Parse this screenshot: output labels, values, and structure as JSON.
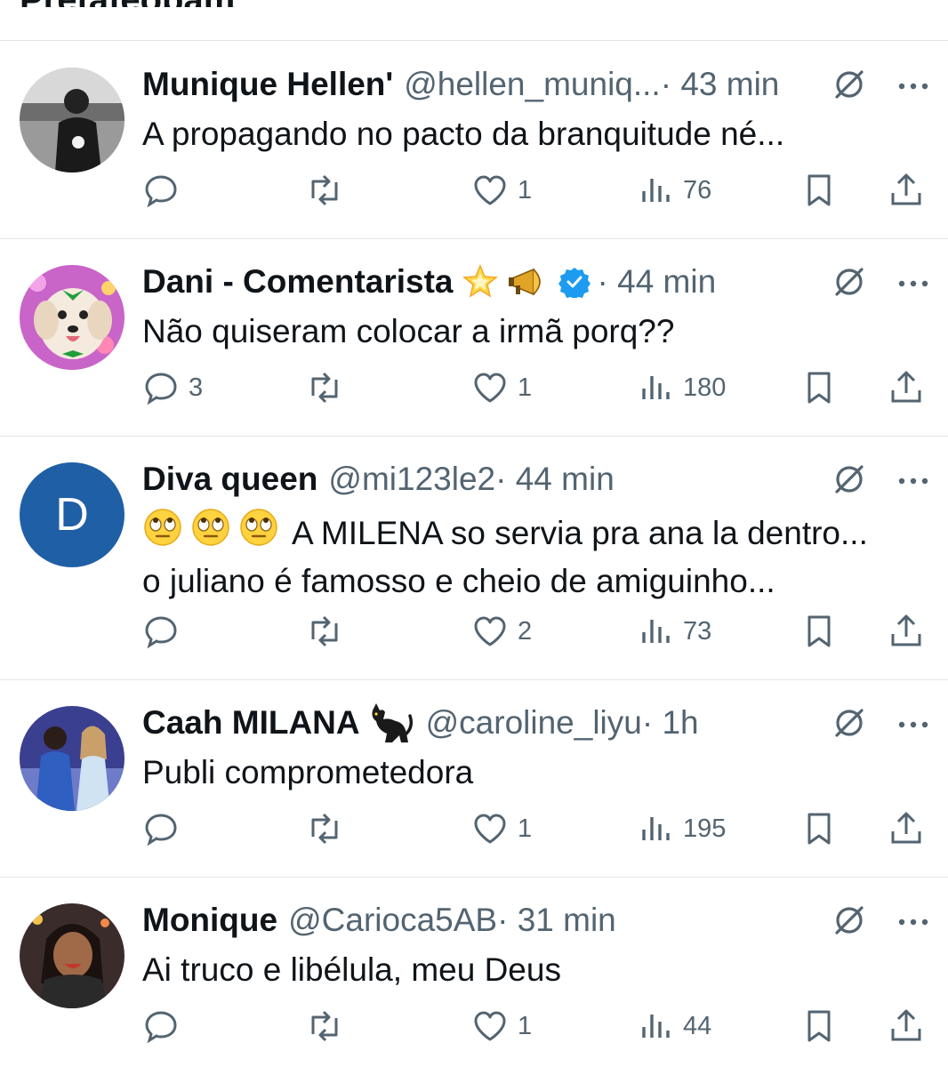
{
  "page": {
    "title_partial": "Pretafeopam"
  },
  "colors": {
    "text": "#0f1419",
    "secondary": "#536471",
    "divider": "#e1e6ea",
    "verified": "#1d9bf0"
  },
  "tweets": [
    {
      "name": "Munique Hellen'",
      "handle": "@hellen_muniq...",
      "time": "· 43 min",
      "lines": [
        "A propagando no pacto da branquitude né..."
      ],
      "replies": "",
      "retweets": "",
      "likes": "1",
      "views": "76",
      "avatar": "photo-person"
    },
    {
      "name": "Dani - Comentarista",
      "handle": "",
      "time": "· 44 min",
      "emojis": [
        "glowing-star-emoji",
        "megaphone-emoji"
      ],
      "verified": true,
      "lines": [
        "Não quiseram colocar a irmã porq??"
      ],
      "replies": "3",
      "retweets": "",
      "likes": "1",
      "views": "180",
      "avatar": "photo-dog"
    },
    {
      "name": "Diva queen",
      "handle": "@mi123le2",
      "time": "· 44 min",
      "lines": [
        "A MILENA so servia pra ana la dentro...",
        "o juliano é famosso e cheio de amiguinho..."
      ],
      "line_emojis": [
        "eye-roll-emoji",
        "eye-roll-emoji",
        "eye-roll-emoji"
      ],
      "replies": "",
      "retweets": "",
      "likes": "2",
      "views": "73",
      "avatar": "letter",
      "avatar_letter": "D",
      "avatar_color": "#1f5fa6"
    },
    {
      "name": "Caah MILANA",
      "handle": "@caroline_liyu",
      "time": "· 1h",
      "emojis": [
        "black-cat-emoji"
      ],
      "lines": [
        "Publi comprometedora"
      ],
      "replies": "",
      "retweets": "",
      "likes": "1",
      "views": "195",
      "avatar": "photo-group"
    },
    {
      "name": "Monique",
      "handle": "@Carioca5AB",
      "time": "· 31 min",
      "lines": [
        "Ai truco e libélula, meu Deus"
      ],
      "replies": "",
      "retweets": "",
      "likes": "1",
      "views": "44",
      "avatar": "photo-woman"
    }
  ]
}
